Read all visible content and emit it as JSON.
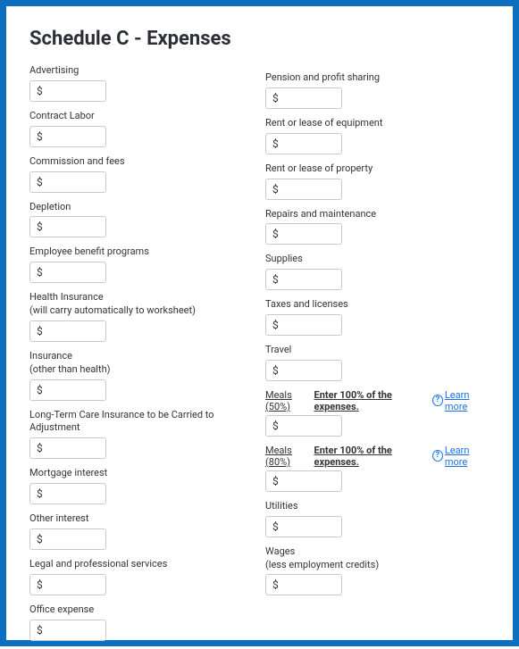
{
  "page": {
    "title": "Schedule C - Expenses"
  },
  "currency_prefix": "$",
  "learn_more": "Learn more",
  "help_glyph": "?",
  "left": {
    "advertising": {
      "label": "Advertising"
    },
    "contract_labor": {
      "label": "Contract Labor"
    },
    "commission_fees": {
      "label": "Commission and fees"
    },
    "depletion": {
      "label": "Depletion"
    },
    "employee_benefit": {
      "label": "Employee benefit programs"
    },
    "health_insurance": {
      "label": "Health Insurance",
      "sublabel": "(will carry automatically to worksheet)"
    },
    "insurance_other": {
      "label": "Insurance",
      "sublabel": "(other than health)"
    },
    "long_term_care": {
      "label": "Long-Term Care Insurance to be Carried to Adjustment"
    },
    "mortgage_interest": {
      "label": "Mortgage interest"
    },
    "other_interest": {
      "label": "Other interest"
    },
    "legal_professional": {
      "label": "Legal and professional services"
    },
    "office_expense": {
      "label": "Office expense"
    }
  },
  "right": {
    "pension_profit": {
      "label": "Pension and profit sharing"
    },
    "rent_equipment": {
      "label": "Rent or lease of equipment"
    },
    "rent_property": {
      "label": "Rent or lease of property"
    },
    "repairs_maintenance": {
      "label": "Repairs and maintenance"
    },
    "supplies": {
      "label": "Supplies"
    },
    "taxes_licenses": {
      "label": "Taxes and licenses"
    },
    "travel": {
      "label": "Travel"
    },
    "meals_50": {
      "prefix": "Meals (50%) ",
      "bold": "Enter 100% of the expenses."
    },
    "meals_80": {
      "prefix": "Meals (80%) ",
      "bold": "Enter 100% of the expenses."
    },
    "utilities": {
      "label": "Utilities"
    },
    "wages": {
      "label": "Wages",
      "sublabel": "(less employment credits)"
    }
  }
}
